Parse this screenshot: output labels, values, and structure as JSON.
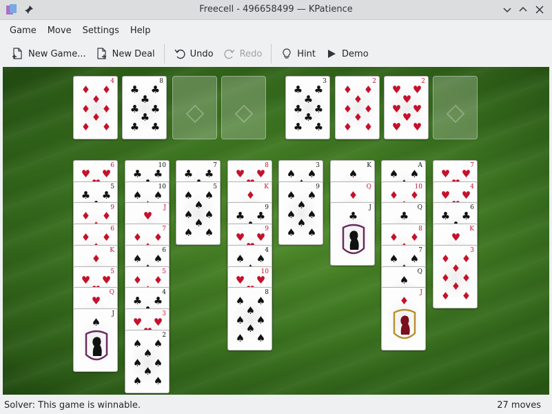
{
  "window": {
    "title": "Freecell - 496658499 — KPatience"
  },
  "menu": [
    "Game",
    "Move",
    "Settings",
    "Help"
  ],
  "toolbar": {
    "new_game": "New Game...",
    "new_deal": "New Deal",
    "undo": "Undo",
    "redo": "Redo",
    "hint": "Hint",
    "demo": "Demo"
  },
  "freecells": [
    {
      "rank": "4",
      "suit": "♦",
      "color": "red"
    },
    {
      "rank": "8",
      "suit": "♣",
      "color": "black"
    },
    null,
    null
  ],
  "foundations": [
    {
      "rank": "3",
      "suit": "♣",
      "color": "black"
    },
    {
      "rank": "2",
      "suit": "♦",
      "color": "red"
    },
    {
      "rank": "2",
      "suit": "♥",
      "color": "red"
    },
    null
  ],
  "tableau": [
    [
      {
        "rank": "6",
        "suit": "♥",
        "color": "red"
      },
      {
        "rank": "5",
        "suit": "♣",
        "color": "black"
      },
      {
        "rank": "9",
        "suit": "♦",
        "color": "red"
      },
      {
        "rank": "6",
        "suit": "♦",
        "color": "red"
      },
      {
        "rank": "K",
        "suit": "♦",
        "color": "red"
      },
      {
        "rank": "5",
        "suit": "♥",
        "color": "red"
      },
      {
        "rank": "Q",
        "suit": "♥",
        "color": "red"
      },
      {
        "rank": "J",
        "suit": "♠",
        "color": "black"
      }
    ],
    [
      {
        "rank": "10",
        "suit": "♣",
        "color": "black"
      },
      {
        "rank": "10",
        "suit": "♠",
        "color": "black"
      },
      {
        "rank": "J",
        "suit": "♥",
        "color": "red"
      },
      {
        "rank": "7",
        "suit": "♦",
        "color": "red"
      },
      {
        "rank": "6",
        "suit": "♠",
        "color": "black"
      },
      {
        "rank": "5",
        "suit": "♦",
        "color": "red"
      },
      {
        "rank": "4",
        "suit": "♣",
        "color": "black"
      },
      {
        "rank": "3",
        "suit": "♥",
        "color": "red"
      },
      {
        "rank": "2",
        "suit": "♠",
        "color": "black"
      }
    ],
    [
      {
        "rank": "7",
        "suit": "♣",
        "color": "black"
      },
      {
        "rank": "5",
        "suit": "♠",
        "color": "black"
      }
    ],
    [
      {
        "rank": "8",
        "suit": "♥",
        "color": "red"
      },
      {
        "rank": "K",
        "suit": "♦",
        "color": "red"
      },
      {
        "rank": "9",
        "suit": "♣",
        "color": "black"
      },
      {
        "rank": "9",
        "suit": "♥",
        "color": "red"
      },
      {
        "rank": "4",
        "suit": "♠",
        "color": "black"
      },
      {
        "rank": "10",
        "suit": "♥",
        "color": "red"
      },
      {
        "rank": "8",
        "suit": "♠",
        "color": "black"
      }
    ],
    [
      {
        "rank": "3",
        "suit": "♠",
        "color": "black"
      },
      {
        "rank": "9",
        "suit": "♠",
        "color": "black"
      }
    ],
    [
      {
        "rank": "K",
        "suit": "♠",
        "color": "black"
      },
      {
        "rank": "Q",
        "suit": "♦",
        "color": "red"
      },
      {
        "rank": "J",
        "suit": "♣",
        "color": "black"
      }
    ],
    [
      {
        "rank": "A",
        "suit": "♠",
        "color": "black"
      },
      {
        "rank": "10",
        "suit": "♦",
        "color": "red"
      },
      {
        "rank": "Q",
        "suit": "♣",
        "color": "black"
      },
      {
        "rank": "8",
        "suit": "♦",
        "color": "red"
      },
      {
        "rank": "7",
        "suit": "♠",
        "color": "black"
      },
      {
        "rank": "Q",
        "suit": "♠",
        "color": "black"
      },
      {
        "rank": "J",
        "suit": "♦",
        "color": "red"
      }
    ],
    [
      {
        "rank": "7",
        "suit": "♥",
        "color": "red"
      },
      {
        "rank": "4",
        "suit": "♥",
        "color": "red"
      },
      {
        "rank": "6",
        "suit": "♣",
        "color": "black"
      },
      {
        "rank": "K",
        "suit": "♥",
        "color": "red"
      },
      {
        "rank": "3",
        "suit": "♦",
        "color": "red"
      }
    ]
  ],
  "status": {
    "message": "Solver: This game is winnable.",
    "moves": "27 moves"
  }
}
